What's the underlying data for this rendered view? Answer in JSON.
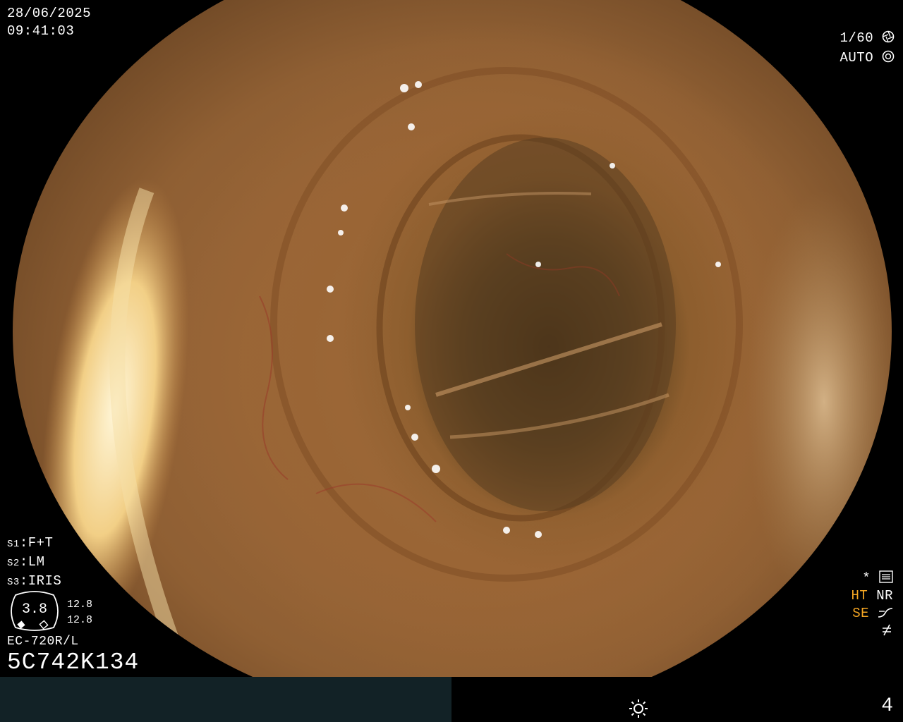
{
  "osd": {
    "date": "28/06/2025",
    "time": "09:41:03",
    "shutter_speed": "1/60",
    "iris_mode": "AUTO",
    "modes": [
      {
        "slot": "S1",
        "value": "F+T"
      },
      {
        "slot": "S2",
        "value": "LM"
      },
      {
        "slot": "S3",
        "value": "IRIS"
      }
    ],
    "zoom_value": "3.8",
    "zoom_numbers": [
      "12.8",
      "12.8"
    ],
    "scope_model": "EC-720R/L",
    "serial": "5C742K134",
    "enhance_symbol": "*",
    "ht": "HT",
    "nr": "NR",
    "se": "SE",
    "status_page": "4"
  },
  "icons": [
    "aperture-icon",
    "iris-icon",
    "settings-icon",
    "curve-icon",
    "not-equal-icon",
    "brightness-icon"
  ],
  "colors": {
    "accent_orange": "#f5a623",
    "status_bar": "#122226"
  }
}
